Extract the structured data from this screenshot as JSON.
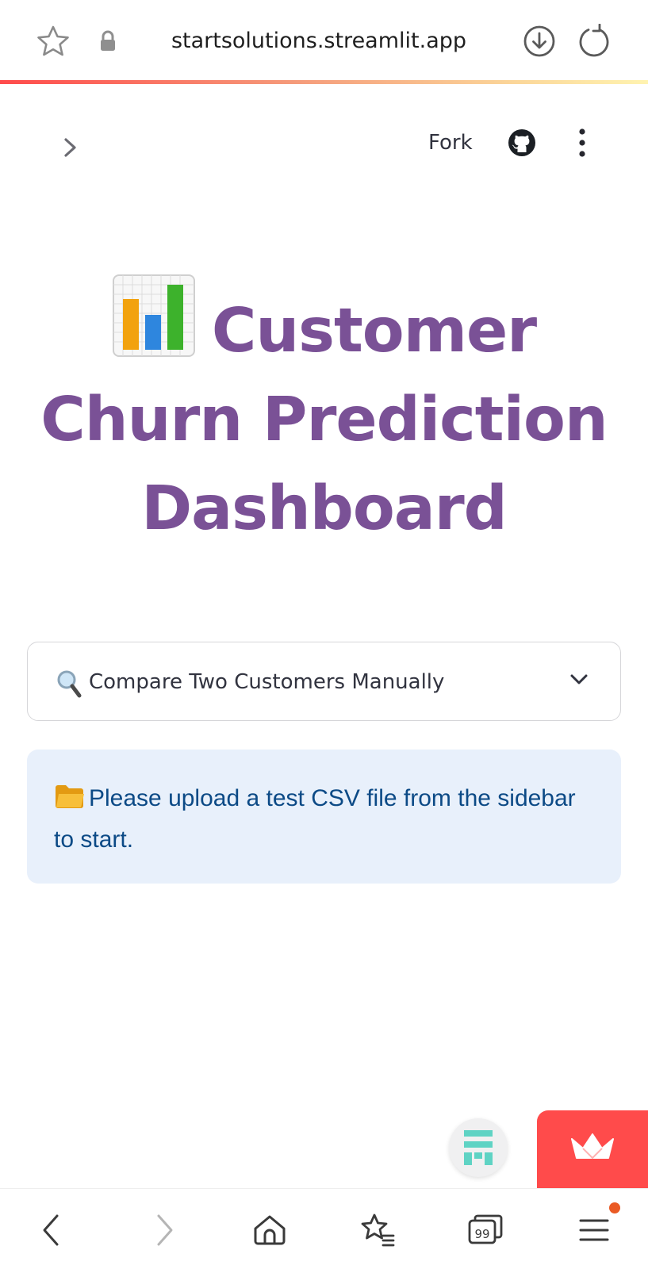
{
  "browser": {
    "url": "startsolutions.streamlit.app",
    "tabs_count": "99",
    "icons": [
      "star-icon",
      "lock-icon",
      "download-icon",
      "reload-icon"
    ]
  },
  "header": {
    "fork_label": "Fork",
    "icons": [
      "chevron-right-icon",
      "github-icon",
      "more-vert-icon"
    ]
  },
  "main": {
    "title_emoji": "bar-chart-emoji",
    "title": "Customer Churn Prediction Dashboard",
    "expander": {
      "icon": "magnifier-icon",
      "label": "Compare Two Customers Manually",
      "expanded": false
    },
    "info": {
      "icon": "folder-icon",
      "message": "Please upload a test CSV file from the sidebar to start."
    }
  },
  "bottom_nav": {
    "items": [
      "back",
      "forward",
      "home",
      "bookmarks",
      "tabs",
      "menu"
    ]
  },
  "colors": {
    "title": "#7a5196",
    "info_bg": "#e8f0fb",
    "info_text": "#0c4a86",
    "streamlit_red": "#ff4b4b"
  }
}
